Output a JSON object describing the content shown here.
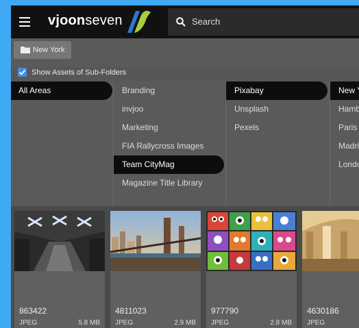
{
  "app": {
    "logo_light": "vjoon",
    "logo_rest": "seven",
    "search_placeholder": "Search"
  },
  "breadcrumb": {
    "label": "New York"
  },
  "options": {
    "show_subfolders_label": "Show Assets of Sub-Folders",
    "show_subfolders_checked": true
  },
  "columns": {
    "areas": [
      "All Areas"
    ],
    "groups": [
      "Branding",
      "invjoo",
      "Marketing",
      "FIA Rallycross Images",
      "Team CityMag",
      "Magazine Title Library"
    ],
    "sources": [
      "Pixabay",
      "Unsplash",
      "Pexels"
    ],
    "cities": [
      "New Y",
      "Hamb",
      "Paris",
      "Madri",
      "Londo"
    ]
  },
  "assets": [
    {
      "id": "863422",
      "type": "JPEG",
      "size": "5.8 MB"
    },
    {
      "id": "4811023",
      "type": "JPEG",
      "size": "2.9 MB"
    },
    {
      "id": "977790",
      "type": "JPEG",
      "size": "2.8 MB"
    },
    {
      "id": "4630186",
      "type": "JPEG",
      "size": ""
    }
  ],
  "colors": {
    "accent": "#3f8fe8",
    "frame": "#3fa9f5",
    "topbar": "#111111"
  }
}
